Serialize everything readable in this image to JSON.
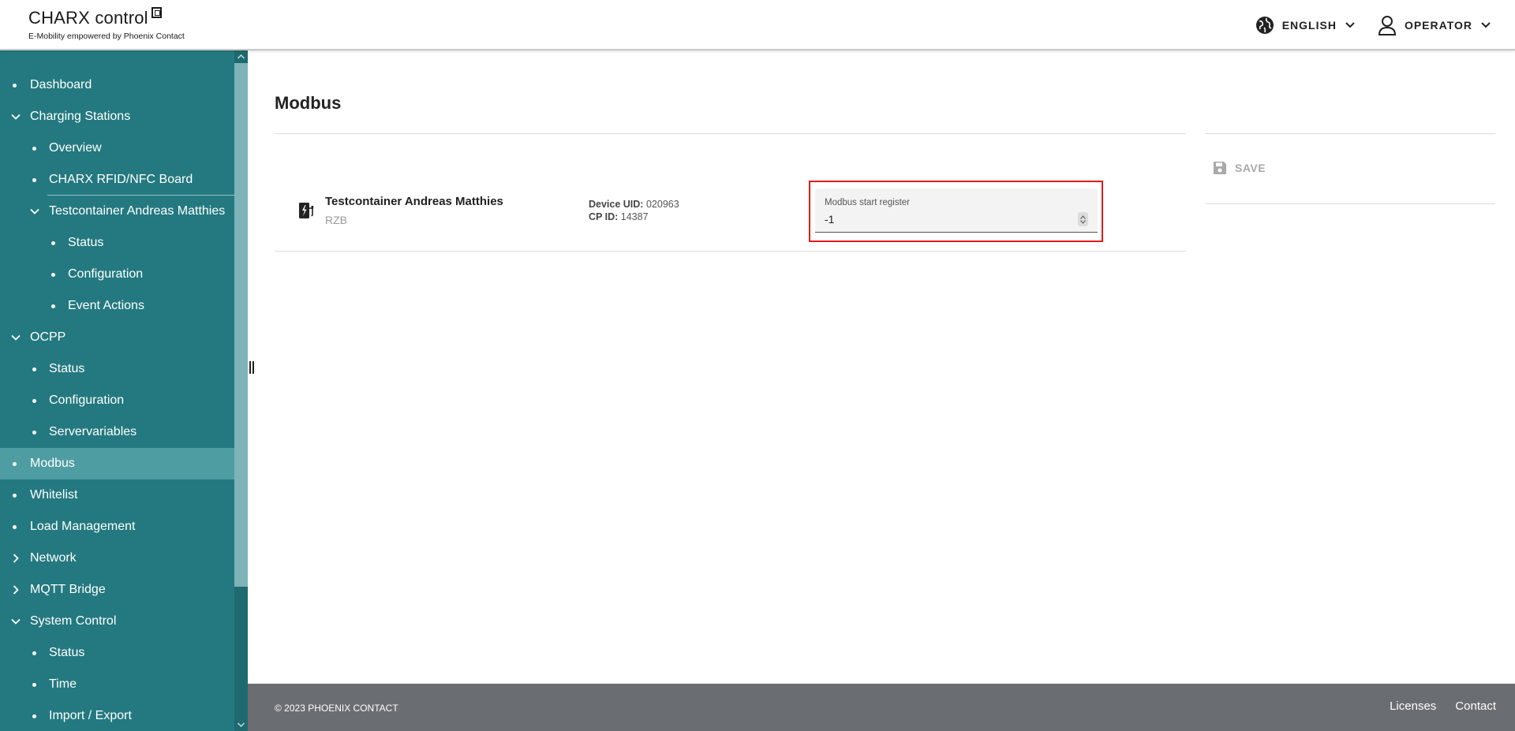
{
  "header": {
    "logo_title": "CHARX control",
    "logo_subtitle": "E-Mobility empowered by Phoenix Contact",
    "language": "ENGLISH",
    "user": "OPERATOR"
  },
  "sidebar": {
    "items": [
      {
        "label": "Dashboard",
        "level": 0,
        "type": "bullet"
      },
      {
        "label": "Charging Stations",
        "level": 0,
        "type": "expanded"
      },
      {
        "label": "Overview",
        "level": 1,
        "type": "bullet"
      },
      {
        "label": "CHARX RFID/NFC Board",
        "level": 1,
        "type": "bullet"
      },
      {
        "label": "Testcontainer Andreas Matthies",
        "level": 1,
        "type": "expanded"
      },
      {
        "label": "Status",
        "level": 2,
        "type": "bullet"
      },
      {
        "label": "Configuration",
        "level": 2,
        "type": "bullet"
      },
      {
        "label": "Event Actions",
        "level": 2,
        "type": "bullet"
      },
      {
        "label": "OCPP",
        "level": 0,
        "type": "expanded"
      },
      {
        "label": "Status",
        "level": 1,
        "type": "bullet"
      },
      {
        "label": "Configuration",
        "level": 1,
        "type": "bullet"
      },
      {
        "label": "Servervariables",
        "level": 1,
        "type": "bullet"
      },
      {
        "label": "Modbus",
        "level": 0,
        "type": "bullet",
        "active": true
      },
      {
        "label": "Whitelist",
        "level": 0,
        "type": "bullet"
      },
      {
        "label": "Load Management",
        "level": 0,
        "type": "bullet"
      },
      {
        "label": "Network",
        "level": 0,
        "type": "collapsed"
      },
      {
        "label": "MQTT Bridge",
        "level": 0,
        "type": "collapsed"
      },
      {
        "label": "System Control",
        "level": 0,
        "type": "expanded"
      },
      {
        "label": "Status",
        "level": 1,
        "type": "bullet"
      },
      {
        "label": "Time",
        "level": 1,
        "type": "bullet"
      },
      {
        "label": "Import / Export",
        "level": 1,
        "type": "bullet"
      }
    ]
  },
  "main": {
    "title": "Modbus",
    "device": {
      "name": "Testcontainer Andreas Matthies",
      "subtitle": "RZB",
      "uid_label": "Device UID:",
      "uid_value": "020963",
      "cpid_label": "CP ID:",
      "cpid_value": "14387"
    },
    "field": {
      "label": "Modbus start register",
      "value": "-1"
    },
    "save_label": "SAVE"
  },
  "footer": {
    "copyright": "© 2023 PHOENIX CONTACT",
    "links": [
      "Licenses",
      "Contact"
    ]
  },
  "colors": {
    "sidebar_bg": "#23797f",
    "sidebar_active": "#4d9da2",
    "footer_bg": "#6a6e72",
    "highlight_border": "#e01a1a"
  }
}
